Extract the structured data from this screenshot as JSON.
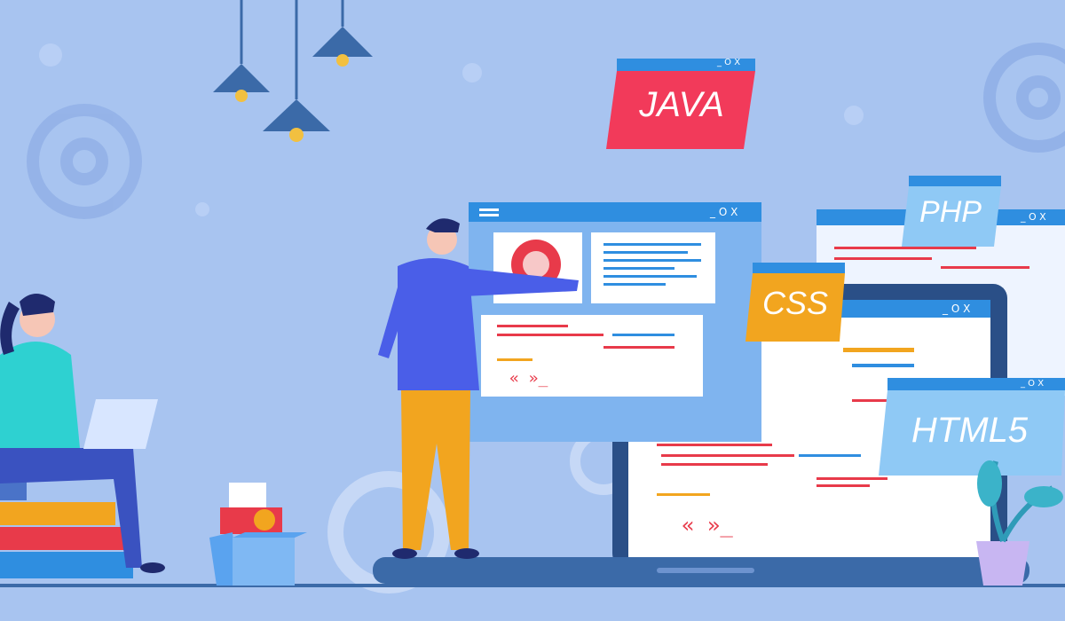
{
  "window_labels": {
    "java": "JAVA",
    "php": "PHP",
    "css": "CSS",
    "html5": "HTML5"
  },
  "window_controls": "_ O X",
  "colors": {
    "background": "#a8c4f0",
    "java_window": "#f23a5a",
    "php_window": "#8fc9f5",
    "css_window": "#f2a51f",
    "html5_window": "#8fc9f5",
    "window_bar": "#2f8ee0",
    "code_red": "#e83a4a",
    "code_blue": "#2f8ee0",
    "code_orange": "#f2a51f"
  },
  "icons": [
    "gear-icon",
    "pendant-lamp-icon",
    "user-avatar-icon",
    "plant-icon",
    "books-icon",
    "box-icon"
  ]
}
